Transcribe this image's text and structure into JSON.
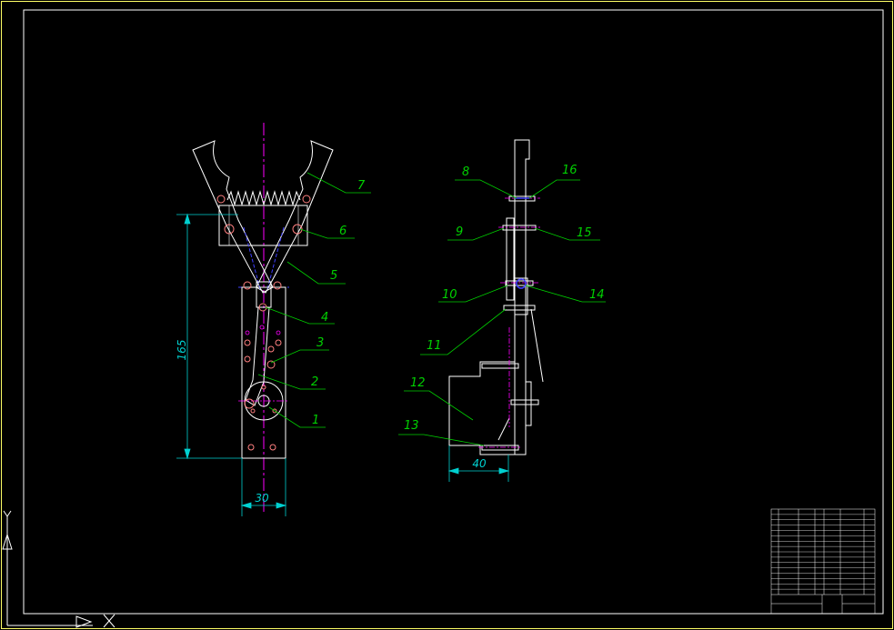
{
  "colors": {
    "background": "#000000",
    "frame": "#ffffff",
    "border": "#ffff66",
    "part_outline": "#ffffff",
    "leader_text": "#00d000",
    "dimension": "#00d0d0",
    "centerline": "#ff00ff",
    "hidden_line": "#4040ff",
    "bolt": "#ff8080"
  },
  "front_view": {
    "dimensions": {
      "height": "165",
      "width": "30"
    }
  },
  "part_numbers": [
    "1",
    "2",
    "3",
    "4",
    "5",
    "6",
    "7",
    "8",
    "9",
    "10",
    "11",
    "12",
    "13",
    "14",
    "15",
    "16"
  ],
  "side_view": {
    "dimensions": {
      "width": "40"
    }
  },
  "ucs_icon": {
    "x_label": "X",
    "y_label": "Y"
  }
}
